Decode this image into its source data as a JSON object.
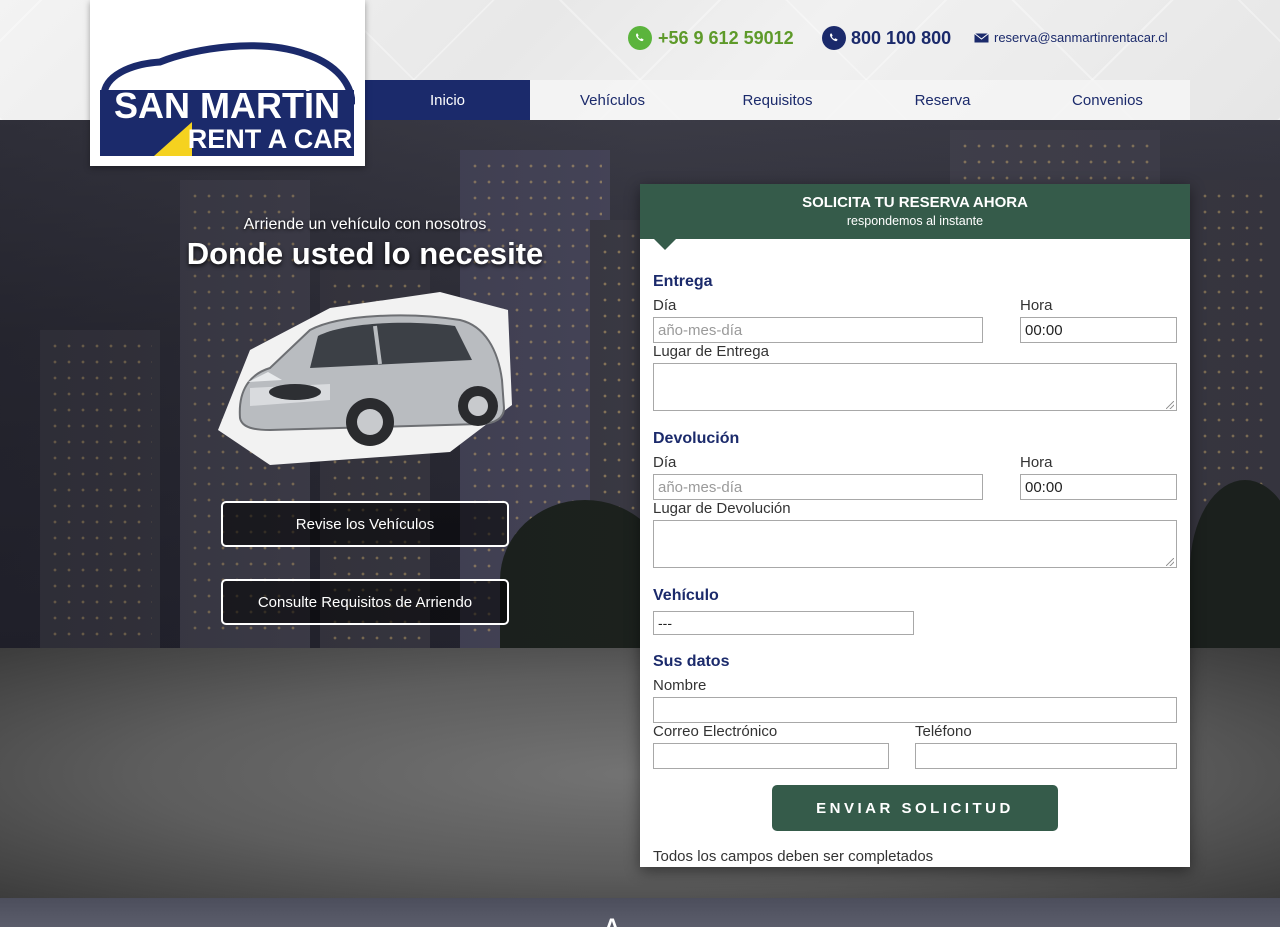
{
  "brand": {
    "logo_line1": "SAN MARTÍN",
    "logo_line2": "RENT A CAR",
    "colors": {
      "navy": "#1b2a6b",
      "yellow": "#f5d21f",
      "green": "#355b4a",
      "whatsapp": "#5bb43c"
    }
  },
  "contact": {
    "whatsapp_icon": "whatsapp-icon",
    "whatsapp_prefix": "+56 9 ",
    "whatsapp_number": "612 59012",
    "phone_icon": "phone-icon",
    "phone": "800 100 800",
    "mail_icon": "envelope-icon",
    "email": "reserva@sanmartinrentacar.cl"
  },
  "nav": {
    "items": [
      {
        "label": "Inicio",
        "active": true
      },
      {
        "label": "Vehículos"
      },
      {
        "label": "Requisitos"
      },
      {
        "label": "Reserva"
      },
      {
        "label": "Convenios"
      }
    ]
  },
  "hero": {
    "subtitle": "Arriende un vehículo con nosotros",
    "title": "Donde usted lo necesite",
    "buttons": {
      "vehicles": "Revise los Vehículos",
      "requirements": "Consulte Requisitos de Arriendo"
    }
  },
  "form": {
    "header_title": "SOLICITA TU RESERVA AHORA",
    "header_subtitle": "respondemos al instante",
    "delivery": {
      "section": "Entrega",
      "day_label": "Día",
      "day_placeholder": "año-mes-día",
      "hour_label": "Hora",
      "hour_value": "00:00",
      "place_label": "Lugar de Entrega"
    },
    "return": {
      "section": "Devolución",
      "day_label": "Día",
      "day_placeholder": "año-mes-día",
      "hour_label": "Hora",
      "hour_value": "00:00",
      "place_label": "Lugar de Devolución"
    },
    "vehicle": {
      "section": "Vehículo",
      "selected": "---"
    },
    "personal": {
      "section": "Sus datos",
      "name_label": "Nombre",
      "email_label": "Correo Electrónico",
      "phone_label": "Teléfono"
    },
    "submit": "ENVIAR SOLICITUD",
    "note": "Todos los campos deben ser completados"
  },
  "footer": {
    "partial_glyph": "A"
  }
}
